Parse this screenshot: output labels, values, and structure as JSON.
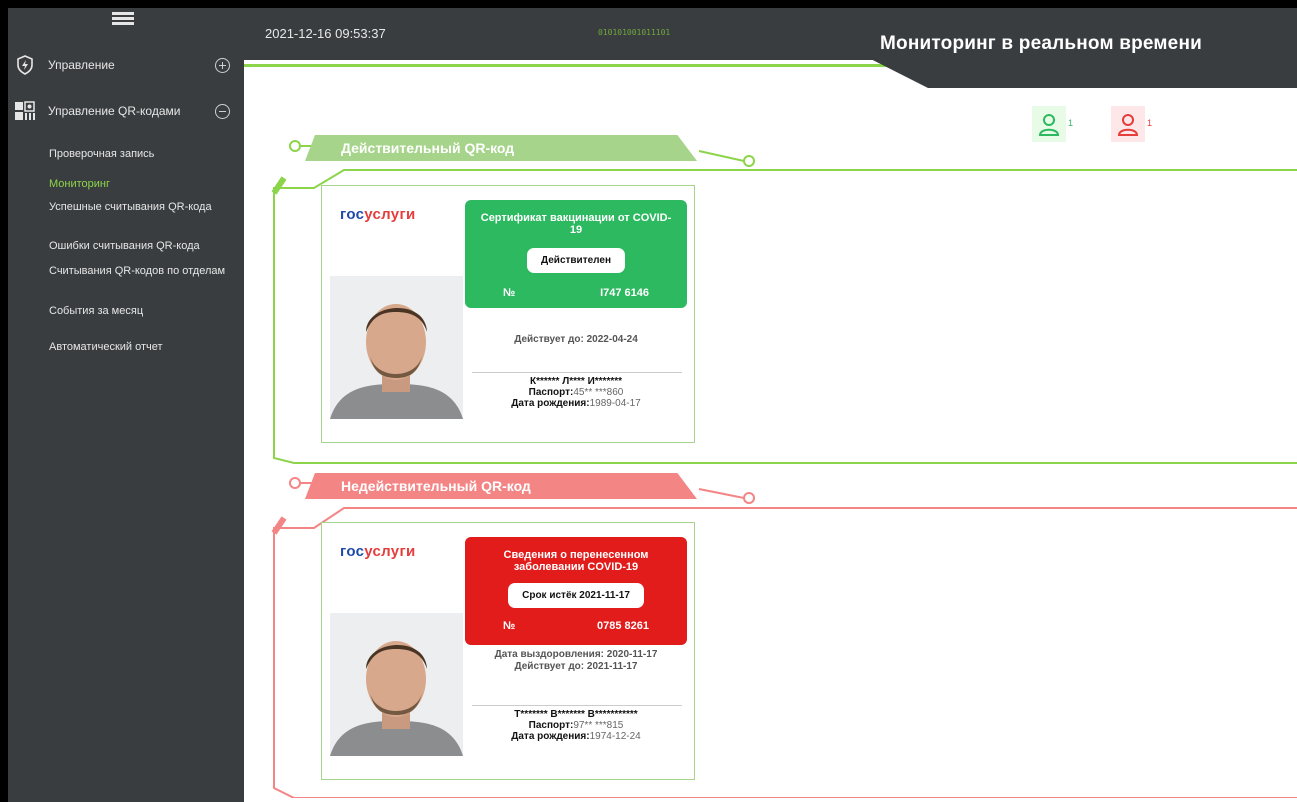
{
  "header": {
    "timestamp": "2021-12-16 09:53:37",
    "title": "Мониторинг в реальном времени",
    "binary_text": "010101001011101"
  },
  "sidebar": {
    "groups": [
      {
        "label": "Управление",
        "icon": "shield-bolt-icon",
        "expanded": false
      },
      {
        "label": "Управление QR-кодами",
        "icon": "qr-code-icon",
        "expanded": true
      }
    ],
    "items": [
      {
        "label": "Проверочная запись",
        "active": false
      },
      {
        "label": "Мониторинг",
        "active": true
      },
      {
        "label": "Успешные считывания QR-кода",
        "active": false
      },
      {
        "label": "Ошибки считывания QR-кода",
        "active": false
      },
      {
        "label": "Считывания QR-кодов по отделам",
        "active": false
      },
      {
        "label": "События за месяц",
        "active": false
      },
      {
        "label": "Автоматический отчет",
        "active": false
      }
    ]
  },
  "counters": {
    "valid_count": "1",
    "invalid_count": "1",
    "valid_color": "#2db960",
    "invalid_color": "#e53c3c"
  },
  "sections": {
    "valid_label": "Действительный QR-код",
    "invalid_label": "Недействительный QR-код",
    "valid_color": "#a6d48a",
    "invalid_color": "#f48585"
  },
  "cards": [
    {
      "logo_part1": "гос",
      "logo_part2": "услуги",
      "cert_title": "Сертификат вакцинации от COVID-19",
      "status": "Действителен",
      "number_label": "№",
      "number": "I747 6146",
      "line1": "Действует до: 2022-04-24",
      "line2": "",
      "name": "К****** Л**** И*******",
      "passport_label": "Паспорт:",
      "passport": "45** ***860",
      "dob_label": "Дата рождения:",
      "dob": "1989-04-17"
    },
    {
      "logo_part1": "гос",
      "logo_part2": "услуги",
      "cert_title": "Сведения о перенесенном заболевании COVID-19",
      "status": "Срок истёк 2021-11-17",
      "number_label": "№",
      "number": "0785 8261",
      "line1": "Дата выздоровления: 2020-11-17",
      "line2": "Действует до: 2021-11-17",
      "name": "Т******* В******* В***********",
      "passport_label": "Паспорт:",
      "passport": "97** ***815",
      "dob_label": "Дата рождения:",
      "dob": "1974-12-24"
    }
  ]
}
